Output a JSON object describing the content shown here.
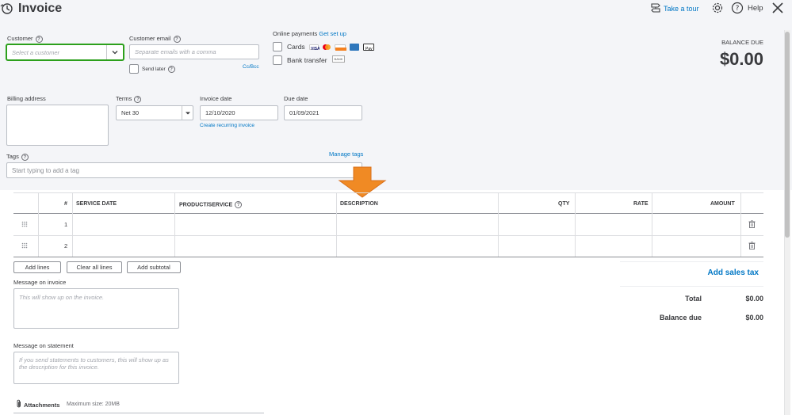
{
  "header": {
    "title": "Invoice",
    "take_tour": "Take a tour",
    "help": "Help"
  },
  "customer": {
    "label": "Customer",
    "placeholder": "Select a customer"
  },
  "email": {
    "label": "Customer email",
    "placeholder": "Separate emails with a comma",
    "send_later": "Send later",
    "cc_bcc": "Cc/Bcc"
  },
  "online_payments": {
    "label": "Online payments",
    "get_set_up": "Get set up",
    "cards": "Cards",
    "bank_transfer": "Bank transfer",
    "bank_badge": "BANK"
  },
  "balance": {
    "label": "BALANCE DUE",
    "amount": "$0.00"
  },
  "billing": {
    "label": "Billing address"
  },
  "terms": {
    "label": "Terms",
    "value": "Net 30"
  },
  "invoice_date": {
    "label": "Invoice date",
    "value": "12/10/2020",
    "recurring_link": "Create recurring invoice"
  },
  "due_date": {
    "label": "Due date",
    "value": "01/09/2021"
  },
  "tags": {
    "label": "Tags",
    "manage": "Manage tags",
    "placeholder": "Start typing to add a tag"
  },
  "table": {
    "columns": [
      "#",
      "SERVICE DATE",
      "PRODUCT/SERVICE",
      "DESCRIPTION",
      "QTY",
      "RATE",
      "AMOUNT"
    ],
    "rows": [
      {
        "num": "1"
      },
      {
        "num": "2"
      }
    ]
  },
  "buttons": {
    "add_lines": "Add lines",
    "clear_all": "Clear all lines",
    "add_subtotal": "Add subtotal"
  },
  "totals": {
    "add_sales_tax": "Add sales tax",
    "total_label": "Total",
    "total_value": "$0.00",
    "balance_due_label": "Balance due",
    "balance_due_value": "$0.00"
  },
  "message_invoice": {
    "label": "Message on invoice",
    "placeholder": "This will show up on the invoice."
  },
  "message_statement": {
    "label": "Message on statement",
    "placeholder": "If you send statements to customers, this will show up as the description for this invoice."
  },
  "attachments": {
    "label": "Attachments",
    "max_size": "Maximum size: 20MB"
  },
  "colors": {
    "accent_green": "#2ca01c",
    "link_blue": "#0077c5",
    "arrow_orange": "#f08a24",
    "header_bg": "#f4f5f8"
  }
}
